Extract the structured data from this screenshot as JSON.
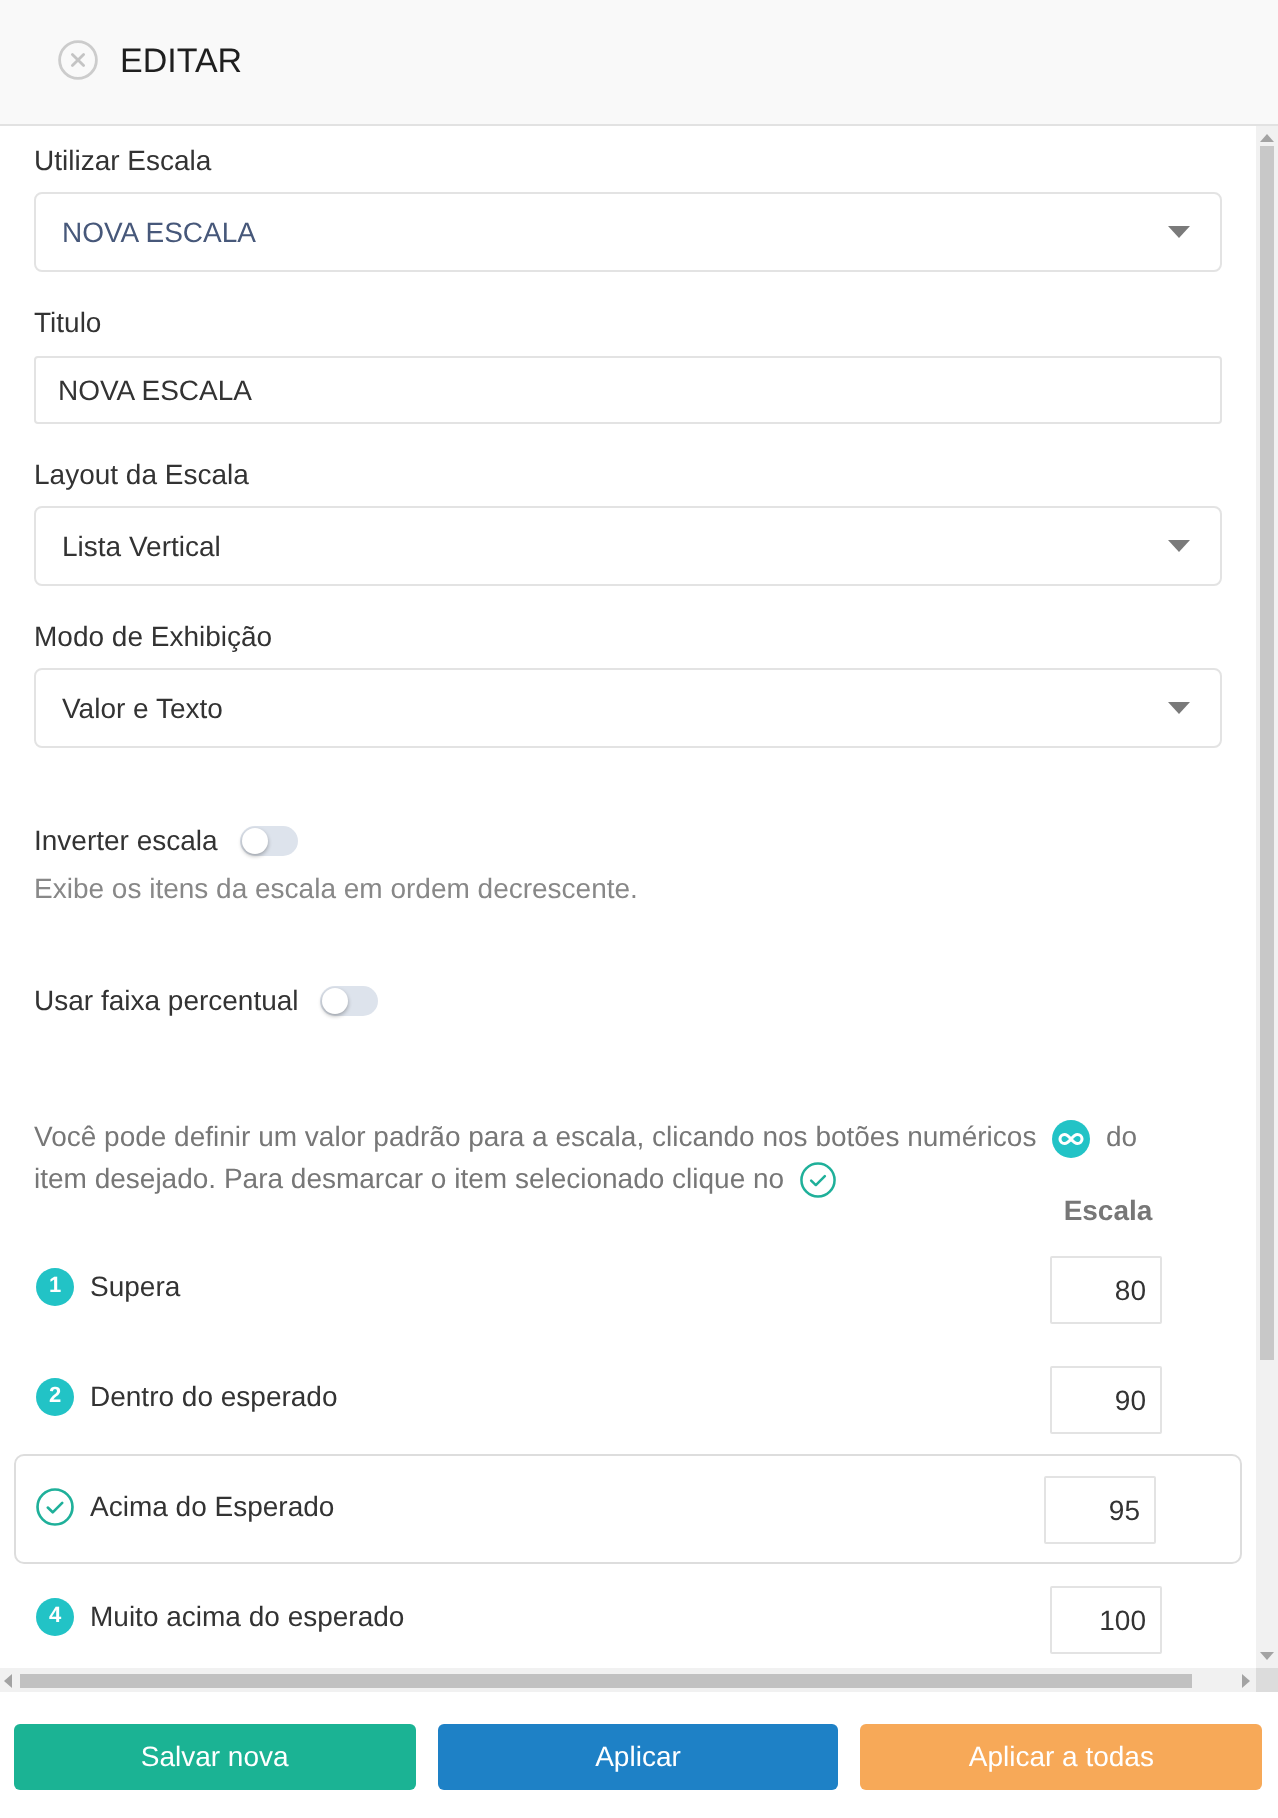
{
  "header": {
    "title": "EDITAR"
  },
  "fields": [
    {
      "kind": "combobox",
      "label": "Utilizar Escala",
      "value": "NOVA ESCALA"
    },
    {
      "kind": "text",
      "label": "Titulo",
      "value": "NOVA ESCALA"
    },
    {
      "kind": "select",
      "label": "Layout da Escala",
      "value": "Lista Vertical"
    },
    {
      "kind": "select",
      "label": "Modo de Exhibição",
      "value": "Valor e Texto"
    }
  ],
  "switches": [
    {
      "label": "Inverter escala",
      "on": false,
      "description": "Exibe os itens da escala em ordem decrescente."
    },
    {
      "label": "Usar faixa percentual",
      "on": false
    }
  ],
  "hint": [
    {
      "kind": "text",
      "text": "Você pode definir um valor padrão para a escala, clicando nos botões numéricos"
    },
    {
      "kind": "number-icon"
    },
    {
      "kind": "text",
      "text": "do"
    },
    {
      "kind": "text",
      "text": "item desejado. Para desmarcar o item selecionado clique no"
    },
    {
      "kind": "check-icon"
    }
  ],
  "scale": {
    "column_header": "Escala",
    "items": [
      {
        "number": "1",
        "label": "Supera",
        "value": "80",
        "selected": false
      },
      {
        "number": "2",
        "label": "Dentro do esperado",
        "value": "90",
        "selected": false
      },
      {
        "label": "Acima do Esperado",
        "value": "95",
        "selected": true
      },
      {
        "number": "4",
        "label": "Muito acima do esperado",
        "value": "100",
        "selected": false
      }
    ]
  },
  "buttons": [
    {
      "kind": "success",
      "label": "Salvar nova"
    },
    {
      "kind": "primary",
      "label": "Aplicar"
    },
    {
      "kind": "warning",
      "label": "Aplicar a todas"
    }
  ]
}
